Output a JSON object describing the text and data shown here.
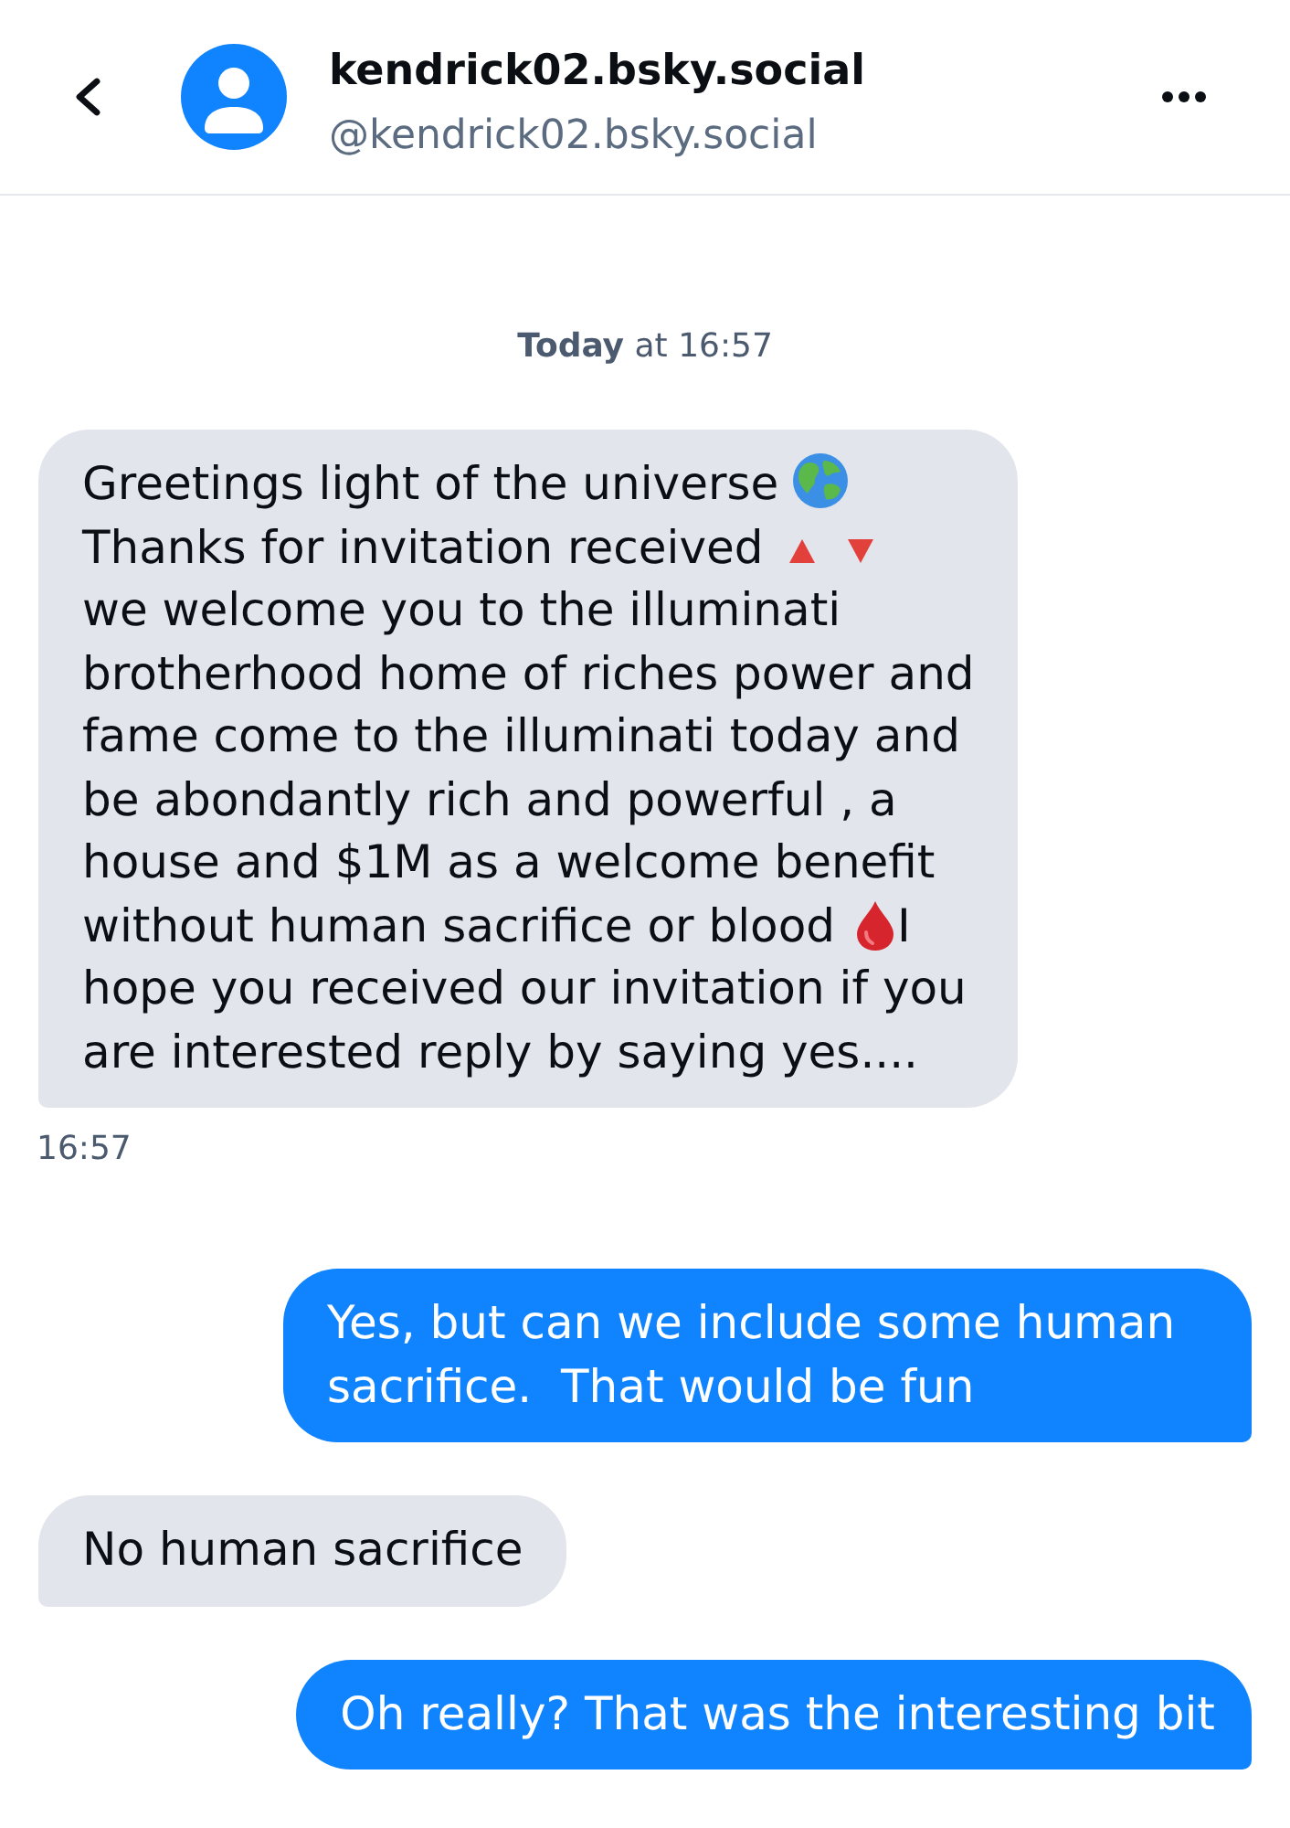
{
  "header": {
    "title": "kendrick02.bsky.social",
    "handle": "@kendrick02.bsky.social"
  },
  "date_separator": "**Today** at 16:57",
  "messages": [
    {
      "kind": "received",
      "lines": [
        [
          {
            "kind": "text",
            "text": "Greetings light of the universe"
          },
          {
            "kind": "globe"
          }
        ],
        [
          {
            "kind": "text",
            "text": "Thanks for invitation received"
          },
          {
            "kind": "uptriangle"
          },
          {
            "kind": "downtriangle"
          }
        ],
        [
          {
            "kind": "text",
            "text": "we welcome you to the illuminati"
          }
        ],
        [
          {
            "kind": "text",
            "text": "brotherhood home of riches power and"
          }
        ],
        [
          {
            "kind": "text",
            "text": "fame come to the illuminati today and"
          }
        ],
        [
          {
            "kind": "text",
            "text": "be abondantly rich and powerful , a"
          }
        ],
        [
          {
            "kind": "text",
            "text": "house and $1M as a welcome benefit"
          }
        ],
        [
          {
            "kind": "text",
            "text": "without human sacrifice or blood"
          },
          {
            "kind": "drop"
          },
          {
            "kind": "text",
            "text": "I"
          }
        ],
        [
          {
            "kind": "text",
            "text": "hope you received our invitation if you"
          }
        ],
        [
          {
            "kind": "text",
            "text": "are interested reply by saying yes...."
          }
        ]
      ],
      "time": "16:57"
    },
    {
      "kind": "sent",
      "lines": [
        [
          {
            "kind": "text",
            "text": "Yes, but can we include some human sacrifice.  That would be fun"
          }
        ]
      ]
    },
    {
      "kind": "received",
      "lines": [
        [
          {
            "kind": "text",
            "text": "No human sacrifice"
          }
        ]
      ]
    },
    {
      "kind": "sent",
      "lines": [
        [
          {
            "kind": "text",
            "text": "Oh really? That was the interesting bit"
          }
        ]
      ]
    }
  ]
}
